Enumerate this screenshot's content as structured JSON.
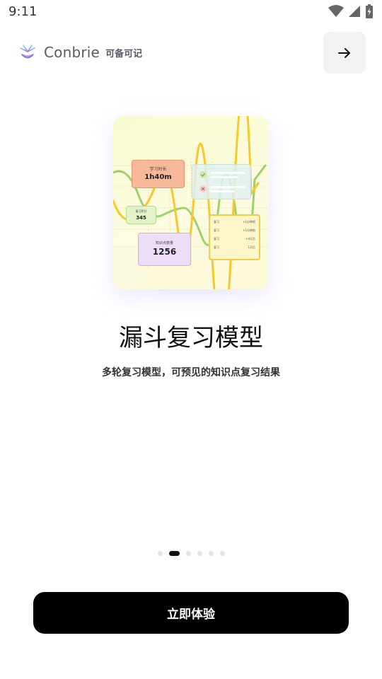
{
  "status": {
    "time": "9:11"
  },
  "brand": {
    "name": "Conbrie",
    "name_cn": "可备可记",
    "accent": "#8e6fe0"
  },
  "header": {
    "skip_icon": "arrow-right-icon"
  },
  "illustration": {
    "study_time_label": "学习时长",
    "study_time_value": "1h40m",
    "score_label": "复习积分",
    "score_value": "345",
    "knowledge_label": "知识点数量",
    "knowledge_value": "1256",
    "table_rows": [
      {
        "left": "复习",
        "right": "+1分钟前"
      },
      {
        "left": "复习",
        "right": "+1分钟前"
      },
      {
        "left": "复习",
        "right": "+4天后"
      },
      {
        "left": "复习",
        "right": "1天后"
      }
    ]
  },
  "onboarding": {
    "title": "漏斗复习模型",
    "subtitle": "多轮复习模型，可预见的知识点复习结果",
    "pages": 6,
    "active_page": 2
  },
  "cta": {
    "label": "立即体验"
  }
}
